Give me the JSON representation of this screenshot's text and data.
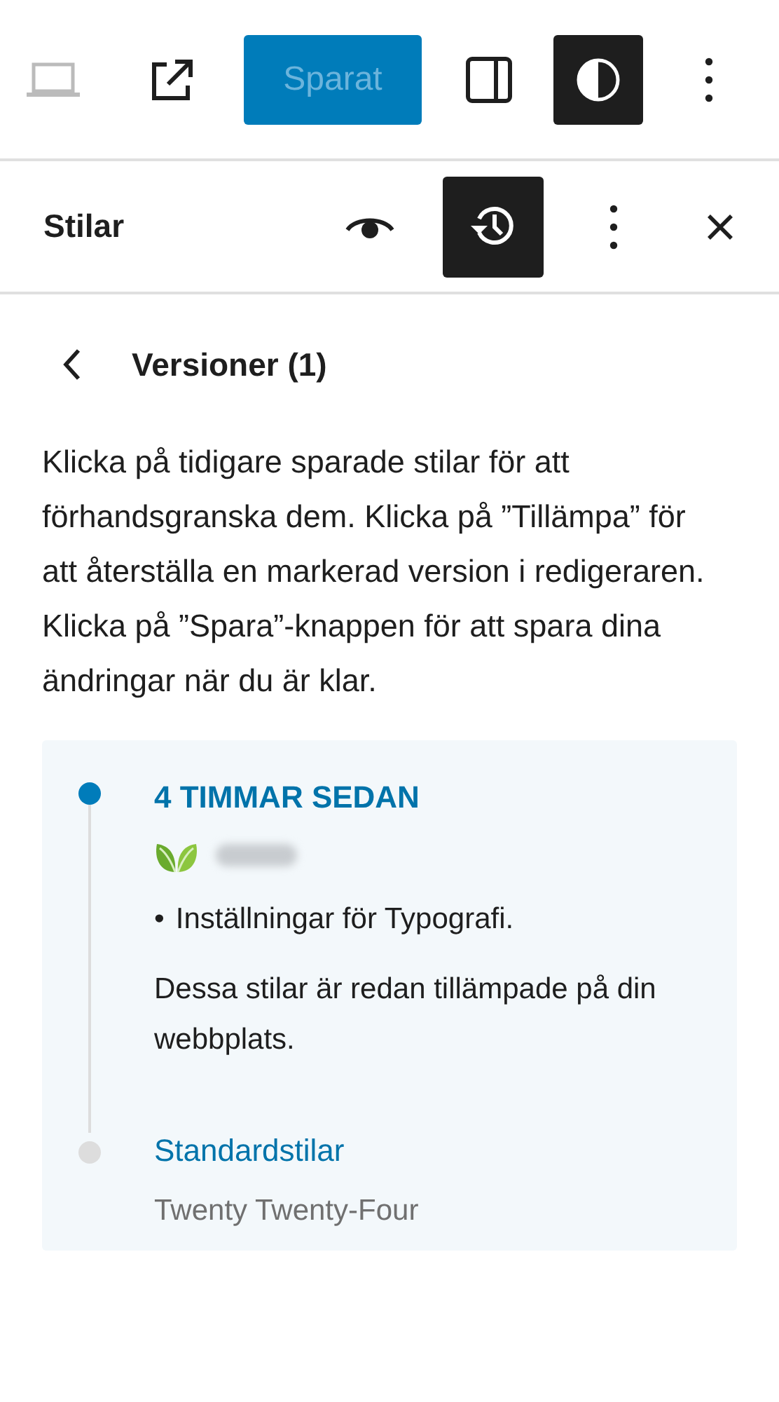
{
  "toolbar": {
    "device_preview": {
      "disabled": true
    },
    "save_button": {
      "label": "Sparat",
      "disabled": true
    },
    "settings_toggle": {
      "pressed": false
    },
    "styles_toggle": {
      "pressed": true
    }
  },
  "panel": {
    "title": "Stilar",
    "revisions_toggle": {
      "pressed": true
    }
  },
  "navigation": {
    "title": "Versioner (1)"
  },
  "description": "Klicka på tidigare sparade stilar för att förhandsgranska dem. Klicka på ”Tillämpa” för att återställa en markerad version i redigeraren. Klicka på ”Spara”-knappen för att spara dina ändringar när du är klar.",
  "revisions": [
    {
      "kind": "revision",
      "selected": true,
      "title": "4 TIMMAR SEDAN",
      "changes": [
        {
          "bullet": "•",
          "text": "Inställningar för Typografi."
        }
      ],
      "note": "Dessa stilar är redan tillämpade på din webbplats."
    },
    {
      "kind": "default",
      "selected": false,
      "title": "Standardstilar",
      "subtitle": "Twenty Twenty-Four"
    }
  ]
}
